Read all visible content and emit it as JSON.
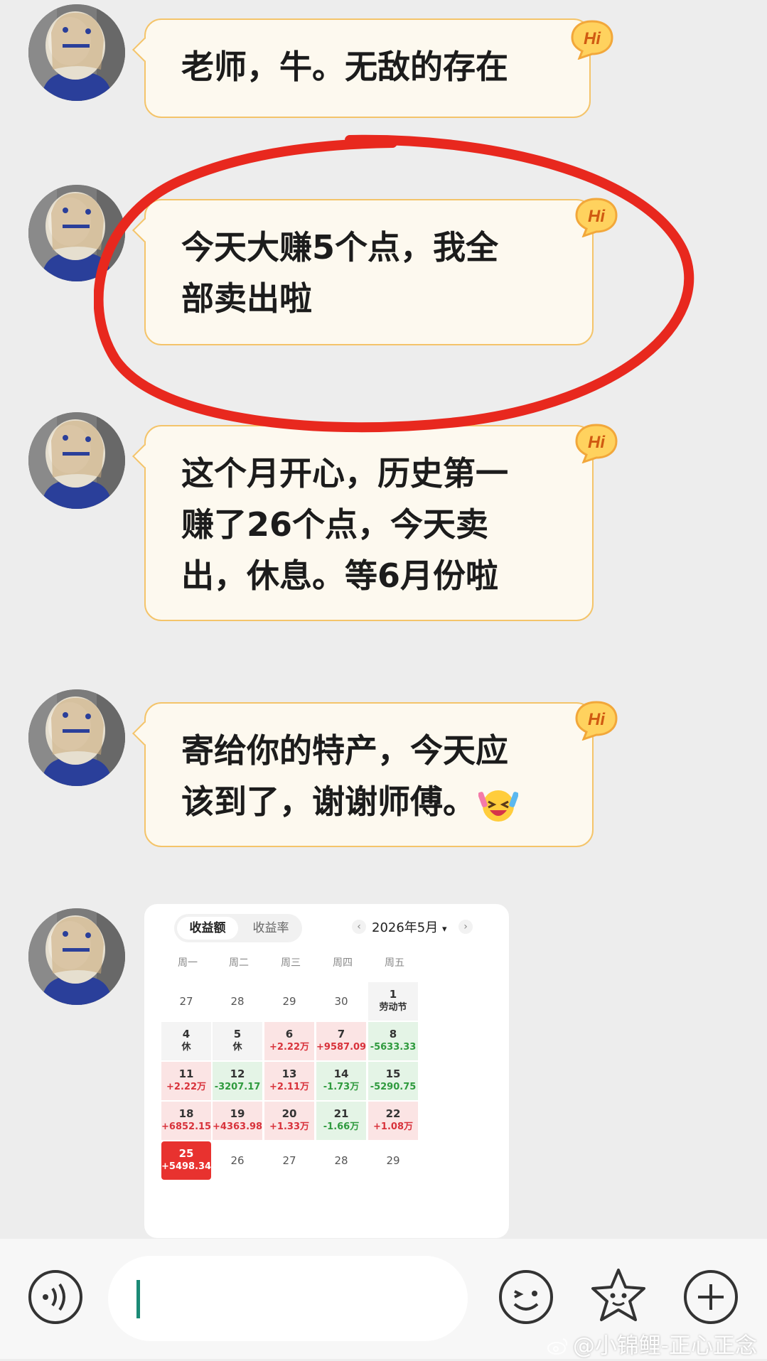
{
  "messages": [
    {
      "lines": [
        "老师，牛。无敌的存在"
      ]
    },
    {
      "lines": [
        "今天大赚5个点，我全",
        "部卖出啦"
      ]
    },
    {
      "lines": [
        "这个月开心，历史第一",
        "赚了26个点，今天卖",
        "出，休息。等6月份啦"
      ]
    },
    {
      "lines": [
        "寄给你的特产，今天应",
        "该到了，谢谢师傅。"
      ]
    }
  ],
  "hi_badge": "Hi",
  "calendar": {
    "tabs": [
      "收益额",
      "收益率"
    ],
    "month_label": "2026年5月",
    "month_caret": "▾",
    "prev": "‹",
    "next": "›",
    "weekdays": [
      "周一",
      "周二",
      "周三",
      "周四",
      "周五"
    ],
    "rows": [
      [
        {
          "d": "27",
          "v": "",
          "s": "plain"
        },
        {
          "d": "28",
          "v": "",
          "s": "plain"
        },
        {
          "d": "29",
          "v": "",
          "s": "plain"
        },
        {
          "d": "30",
          "v": "",
          "s": "plain"
        },
        {
          "d": "1",
          "v": "劳动节",
          "s": "gray"
        }
      ],
      [
        {
          "d": "4",
          "v": "休",
          "s": "gray"
        },
        {
          "d": "5",
          "v": "休",
          "s": "gray"
        },
        {
          "d": "6",
          "v": "+2.22万",
          "s": "red"
        },
        {
          "d": "7",
          "v": "+9587.09",
          "s": "red"
        },
        {
          "d": "8",
          "v": "-5633.33",
          "s": "green"
        }
      ],
      [
        {
          "d": "11",
          "v": "+2.22万",
          "s": "red"
        },
        {
          "d": "12",
          "v": "-3207.17",
          "s": "green"
        },
        {
          "d": "13",
          "v": "+2.11万",
          "s": "red"
        },
        {
          "d": "14",
          "v": "-1.73万",
          "s": "green"
        },
        {
          "d": "15",
          "v": "-5290.75",
          "s": "green"
        }
      ],
      [
        {
          "d": "18",
          "v": "+6852.15",
          "s": "red"
        },
        {
          "d": "19",
          "v": "+4363.98",
          "s": "red"
        },
        {
          "d": "20",
          "v": "+1.33万",
          "s": "red"
        },
        {
          "d": "21",
          "v": "-1.66万",
          "s": "green"
        },
        {
          "d": "22",
          "v": "+1.08万",
          "s": "red"
        }
      ],
      [
        {
          "d": "25",
          "v": "+5498.34",
          "s": "hot"
        },
        {
          "d": "26",
          "v": "",
          "s": "plain"
        },
        {
          "d": "27",
          "v": "",
          "s": "plain"
        },
        {
          "d": "28",
          "v": "",
          "s": "plain"
        },
        {
          "d": "29",
          "v": "",
          "s": "plain"
        }
      ]
    ]
  },
  "input": {
    "value": ""
  },
  "icons": [
    "voice-icon",
    "emoji-icon",
    "sticker-icon",
    "plus-icon"
  ],
  "colors": {
    "bubble_border": "#f4c46a",
    "highlight": "#e8281e",
    "gain": "#d8323b",
    "loss": "#2f9a3e"
  },
  "watermark": "@小锦鲤-正心正念"
}
